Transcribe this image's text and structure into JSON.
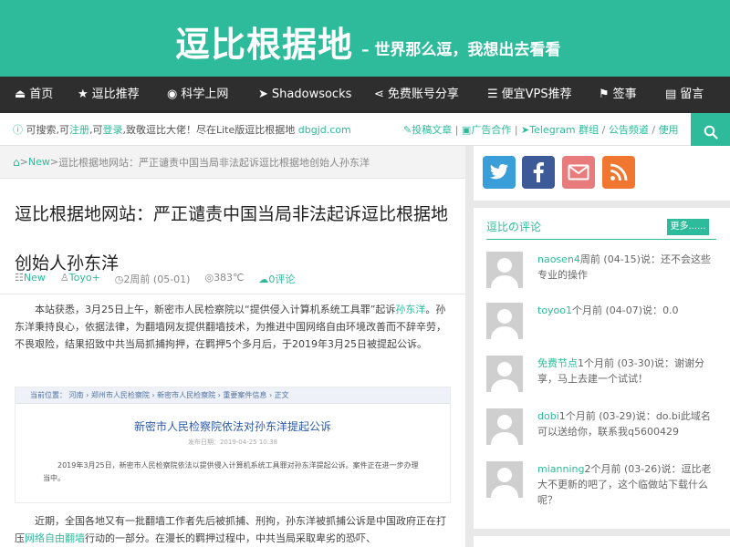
{
  "header": {
    "brand": "逗比根据地",
    "slogan": "– 世界那么逗，我想出去看看"
  },
  "nav": {
    "items": [
      {
        "label": "首页",
        "icon": "eject-icon"
      },
      {
        "label": "逗比推荐",
        "icon": "star-icon"
      },
      {
        "label": "科学上网",
        "icon": "globe-icon"
      },
      {
        "label": "Shadowsocks",
        "icon": "paper-plane-icon"
      },
      {
        "label": "免费账号分享",
        "icon": "share-icon"
      },
      {
        "label": "便宜VPS推荐",
        "icon": "server-icon"
      },
      {
        "label": "签事",
        "icon": "flag-icon"
      },
      {
        "label": "留言",
        "icon": "message-icon"
      }
    ]
  },
  "notice": {
    "part1": "可搜索,可",
    "link1": "注册",
    "part2": ",可",
    "link2": "登录",
    "part3": ",致敬逗比大佬！尽在Lite版逗比根据地",
    "link3": "dbgjd.com",
    "right_link1": "投稿文章",
    "right_sep1": " | ",
    "right_link2": "广告合作",
    "right_sep2": " | ",
    "right_link3": "Telegram 群组",
    "right_sep3": " / ",
    "right_link4": "公告频道",
    "right_sep4": " / ",
    "right_link5": "使用"
  },
  "breadcrumb": {
    "home_sep": " > ",
    "category": "New",
    "sep2": " > ",
    "current": "逗比根据地网站：严正谴责中国当局非法起诉逗比根据地创始人孙东洋"
  },
  "article": {
    "title": "逗比根据地网站：严正谴责中国当局非法起诉逗比根据地创始人孙东洋",
    "meta_category": "New",
    "meta_author": "Toyo+",
    "meta_time": "2周前 (05-01)",
    "meta_views": "383℃",
    "meta_comments": "0评论",
    "para1_a": "本站获悉，3月25日上午，新密市人民检察院以“提供侵入计算机系统工具罪”起诉",
    "para1_link": "孙东洋",
    "para1_b": "。孙东洋秉持良心，依据法律，为翻墙网友提供翻墙技术，为推进中国网络自由环境改善而不辞辛劳，不畏艰险，结果招致中共当局抓捕拘押，在羁押5个多月后，于2019年3月25日被提起公诉。",
    "para2_a": "近期，全国各地又有一批翻墙工作者先后被抓捕、刑拘，孙东洋被抓捕公诉是中国政府正在打压",
    "para2_link": "网络自由",
    "para2_link2": "翻墙",
    "para2_b": "行动的一部分。在漫长的羁押过程中，中共当局采取卑劣的恐吓、",
    "doc": {
      "bar": "当前位置： 河南 › 郑州市人民检察院 › 新密市人民检察院 › 重要案件信息 › 正文",
      "title": "新密市人民检察院依法对孙东洋提起公诉",
      "date": "发布日期：2019-04-25 10:38",
      "body": "2019年3月25日，新密市人民检察院依法以提供侵入计算机系统工具罪对孙东洋提起公诉。案件正在进一步办理当中。"
    }
  },
  "social": [
    {
      "icon": "twitter-icon",
      "color": "#3a9fd9"
    },
    {
      "icon": "facebook-icon",
      "color": "#3b5a97"
    },
    {
      "icon": "mail-icon",
      "color": "#e87b7b"
    },
    {
      "icon": "rss-icon",
      "color": "#f1762f"
    }
  ],
  "comments": {
    "title": "逗比の评论",
    "more": "更多......",
    "items": [
      {
        "user": "naosen4",
        "time": "周前 (04-15)说：",
        "text": "还不会这些专业的操作"
      },
      {
        "user": "toyoo1",
        "time": "个月前 (04-07)说：",
        "text": "0.0"
      },
      {
        "user": "免费节点",
        "time": "1个月前 (03-30)说：",
        "text": "谢谢分享，马上去建一个试试！"
      },
      {
        "user": "dobi",
        "time": "1个月前 (03-29)说：",
        "text": "do.bi此域名可以送给你，联系我q5600429"
      },
      {
        "user": "mianning",
        "time": "2个月前 (03-26)说：",
        "text": "逗比老大不更新的吧了，这个临做站下载什么呢？"
      }
    ]
  }
}
